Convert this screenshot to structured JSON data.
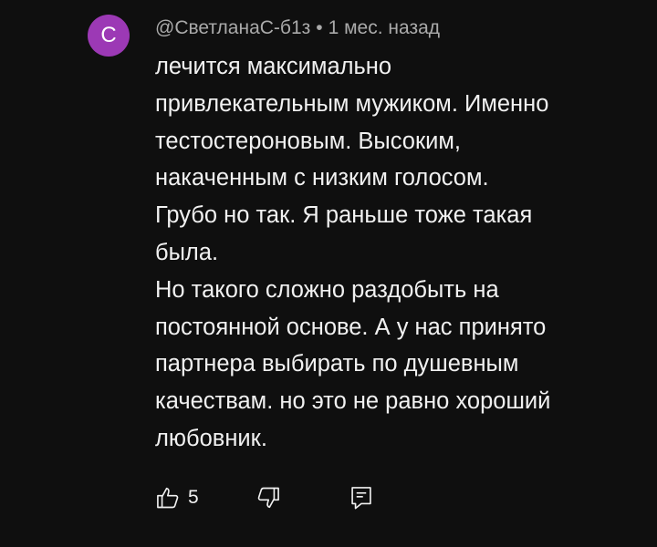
{
  "comment": {
    "avatar_letter": "С",
    "avatar_color": "#9c39b5",
    "author": "@СветланаС-б1з",
    "separator": "•",
    "timestamp": "1 мес. назад",
    "lines": [
      "лечится максимально",
      "привлекательным мужиком. Именно",
      "тестостероновым. Высоким,",
      "накаченным с низким голосом.",
      "Грубо но так. Я раньше тоже такая",
      "была.",
      "Но такого сложно раздобыть на",
      "постоянной основе. А у нас принято",
      "партнера выбирать по душевным",
      "качествам. но это не равно хороший",
      "любовник."
    ],
    "actions": {
      "like_icon": "thumb-up-icon",
      "like_count": "5",
      "dislike_icon": "thumb-down-icon",
      "reply_icon": "reply-comment-icon"
    }
  },
  "colors": {
    "background": "#0f0f0f",
    "text": "#f1f1f1",
    "meta_text": "#aaaaaa"
  }
}
